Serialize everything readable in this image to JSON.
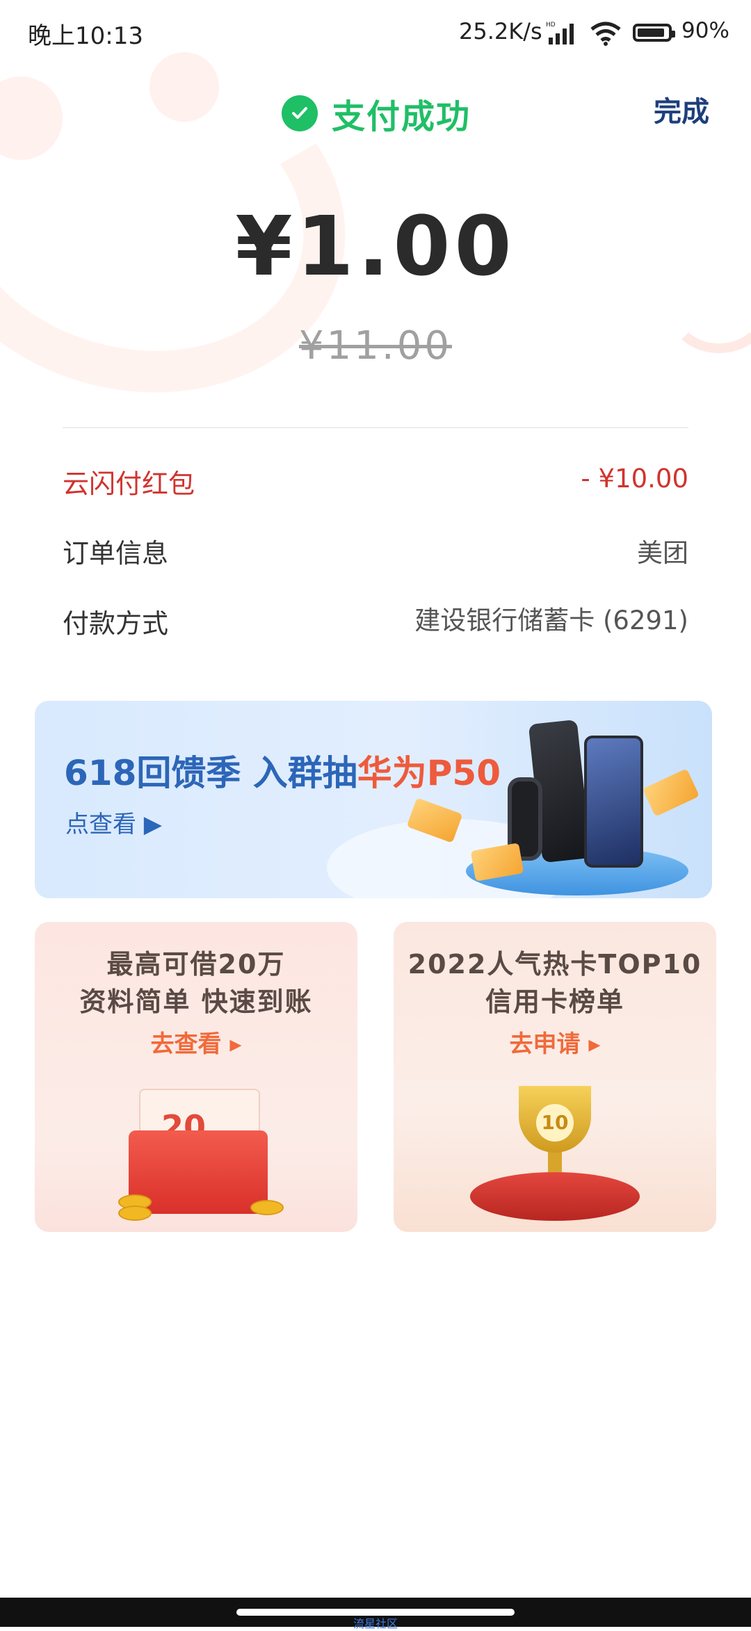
{
  "status_bar": {
    "time": "晚上10:13",
    "network_speed": "25.2K/s",
    "battery": "90%"
  },
  "header": {
    "title": "支付成功",
    "done_label": "完成"
  },
  "payment": {
    "amount": "¥1.00",
    "original_amount": "¥11.00"
  },
  "details": [
    {
      "label": "云闪付红包",
      "value": "- ¥10.00"
    },
    {
      "label": "订单信息",
      "value": "美团"
    },
    {
      "label": "付款方式",
      "value": "建设银行储蓄卡 (6291)"
    }
  ],
  "banner": {
    "title_prefix": "618回馈季 入群抽",
    "title_highlight": "华为P50",
    "link": "点查看 ▶"
  },
  "cards": [
    {
      "line1": "最高可借20万",
      "line2": "资料简单 快速到账",
      "link": "去查看 ▸",
      "badge": "20"
    },
    {
      "line1": "2022人气热卡TOP10",
      "line2": "信用卡榜单",
      "link": "去申请 ▸",
      "badge": "10"
    }
  ],
  "watermark": "流星社区",
  "colors": {
    "success": "#1fbf66",
    "accent_red": "#d0342f",
    "link_blue": "#2c66b8",
    "orange": "#f06a3a"
  }
}
